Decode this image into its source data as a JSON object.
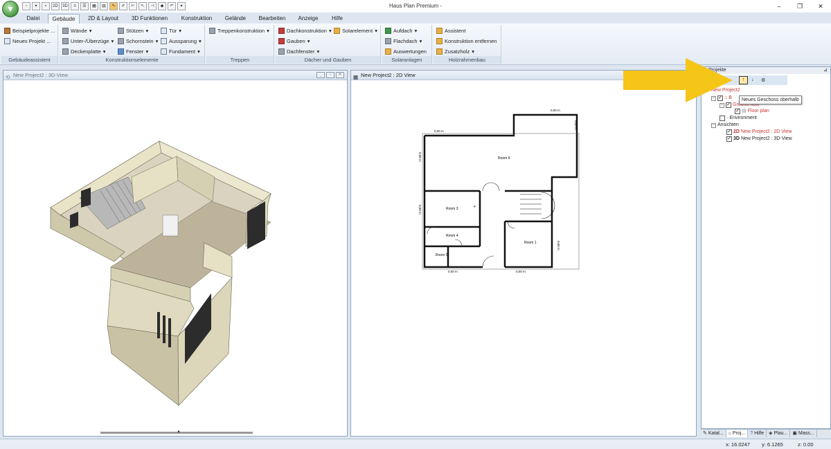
{
  "app": {
    "title": "Haus Plan Premium -"
  },
  "quick_access": [
    "new",
    "open",
    "save",
    "2D",
    "3D",
    "grid",
    "list",
    "print",
    "print2",
    "tool",
    "pencil",
    "cursor",
    "ruler",
    "undo",
    "redo"
  ],
  "menu_tabs": [
    {
      "label": "Datei",
      "active": false
    },
    {
      "label": "Gebäude",
      "active": true
    },
    {
      "label": "2D & Layout",
      "active": false
    },
    {
      "label": "3D Funktionen",
      "active": false
    },
    {
      "label": "Konstruktion",
      "active": false
    },
    {
      "label": "Gelände",
      "active": false
    },
    {
      "label": "Bearbeiten",
      "active": false
    },
    {
      "label": "Anzeige",
      "active": false
    },
    {
      "label": "Hilfe",
      "active": false
    }
  ],
  "ribbon": {
    "gebaeudeassistent": {
      "label": "Gebäudeassistent",
      "items": [
        "Beispielprojekte ...",
        "Neues Projekt ..."
      ]
    },
    "konstruktionselemente": {
      "label": "Konstruktionselemente",
      "col1": [
        "Wände",
        "Unter-/Überzüge",
        "Deckenplatte"
      ],
      "col2": [
        "Stützen",
        "Schornstein",
        "Fenster"
      ],
      "col3": [
        "Tür",
        "Aussparung",
        "Fundament"
      ]
    },
    "treppen": {
      "label": "Treppen",
      "items": [
        "Treppenkonstruktion"
      ]
    },
    "daecher": {
      "label": "Dächer und Gauben",
      "col1": [
        "Dachkonstruktion",
        "Gauben",
        "Dachfenster"
      ],
      "col2": [
        "Solarelement"
      ]
    },
    "solaranlagen": {
      "label": "Solaranlagen",
      "items": [
        "Aufdach",
        "Flachdach",
        "Auswertungen"
      ]
    },
    "holzrahmenbau": {
      "label": "Holzrahmenbau",
      "items": [
        "Assistent",
        "Konstruktion entfernen",
        "Zusatzholz"
      ]
    }
  },
  "panels": {
    "view3d": {
      "title": "New Project2 : 3D-View"
    },
    "view2d": {
      "title": "New Project2 : 2D View"
    },
    "projects": {
      "title": "Projekte"
    }
  },
  "floorplan": {
    "rooms": [
      "Room 6",
      "Room 3",
      "Room 4",
      "Room 5",
      "Room 1"
    ],
    "dimensions": [
      "0,00 m",
      "0,00 m",
      "0,00 m",
      "0,00 m",
      "0,00 m",
      "0,00 m",
      "0,00 m",
      "0,00 m"
    ]
  },
  "tree": {
    "project": "New Project2",
    "building": "B",
    "ground_floor": "Ground floor",
    "floor_plan": "Floor plan",
    "environment": "Environment",
    "views_label": "Ansichten",
    "view2d_prefix": "2D",
    "view2d": "New Project2 : 2D View",
    "view3d_prefix": "3D",
    "view3d": "New Project2 : 3D-View"
  },
  "tooltip": "Neues Geschoss oberhalb",
  "bottom_tabs": [
    "Katal...",
    "Proj...",
    "Hilfe",
    "Plau...",
    "Mass..."
  ],
  "status": {
    "x": "x: 16.0247",
    "y": "y: 6.1265",
    "z": "z: 0.00"
  },
  "colors": {
    "accent_arrow": "#f5c518",
    "ribbon_bg": "#e4ebf4",
    "tree_red": "#c83232"
  }
}
